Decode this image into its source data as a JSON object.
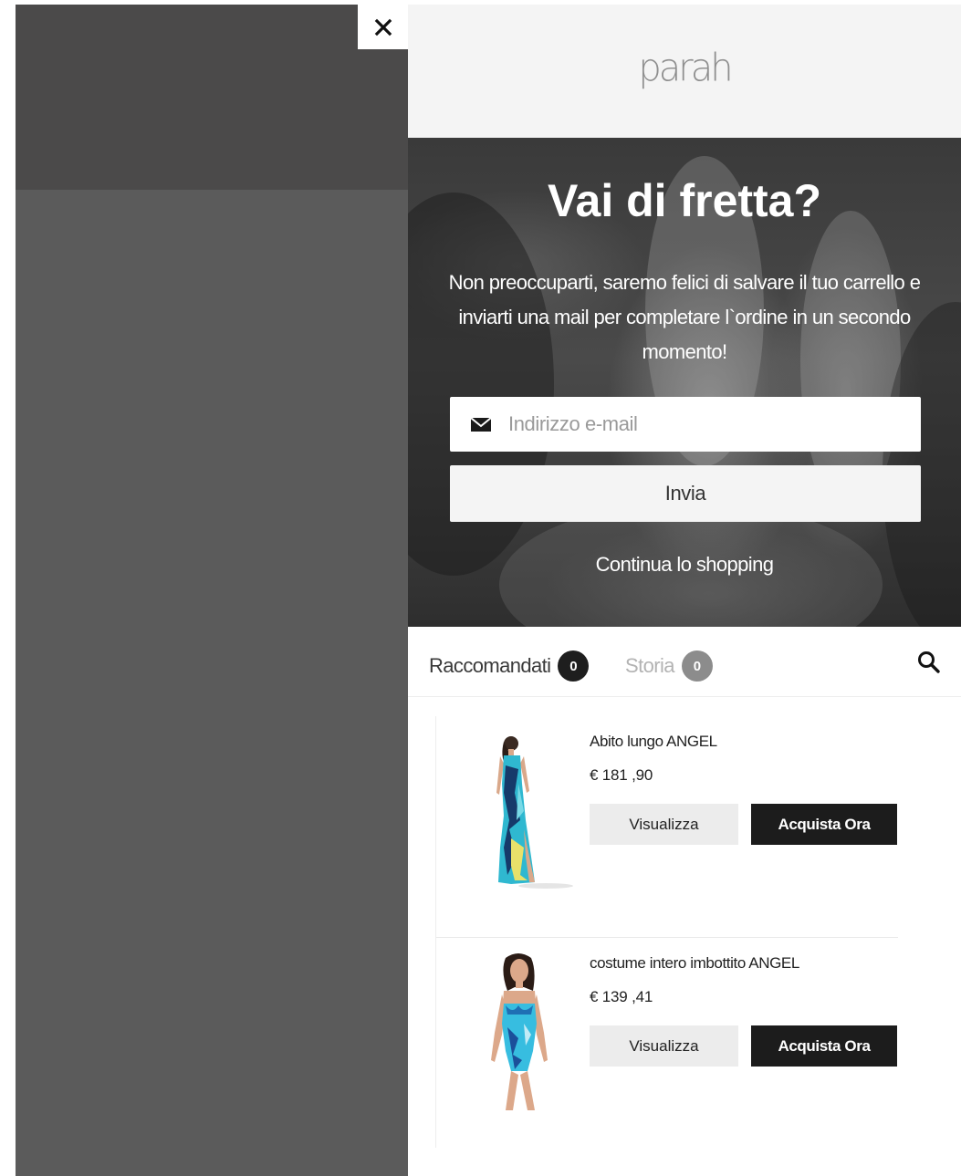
{
  "close": {
    "icon": "close-icon"
  },
  "brand": {
    "logo_text": "parah"
  },
  "hero": {
    "title": "Vai di fretta?",
    "text": "Non preoccuparti, saremo felici di salvare il tuo carrello e inviarti una mail per completare l`ordine in un secondo momento!",
    "email": {
      "icon": "envelope-icon",
      "placeholder": "Indirizzo e-mail",
      "value": ""
    },
    "submit_label": "Invia",
    "continue_label": "Continua lo shopping"
  },
  "tabs": {
    "recommended": {
      "label": "Raccomandati",
      "count": "0"
    },
    "history": {
      "label": "Storia",
      "count": "0"
    },
    "search_icon": "search-icon"
  },
  "products": [
    {
      "name": "Abito lungo ANGEL",
      "price": "€ 181 ,90",
      "view_label": "Visualizza",
      "buy_label": "Acquista Ora"
    },
    {
      "name": "costume intero imbottito ANGEL",
      "price": "€ 139 ,41",
      "view_label": "Visualizza",
      "buy_label": "Acquista Ora"
    }
  ],
  "colors": {
    "overlay_dark": "#4b4a4a",
    "overlay": "#5b5b5b",
    "button_dark": "#1c1c1c",
    "button_light": "#ececec",
    "accent_turquoise": "#2ec4d6"
  }
}
